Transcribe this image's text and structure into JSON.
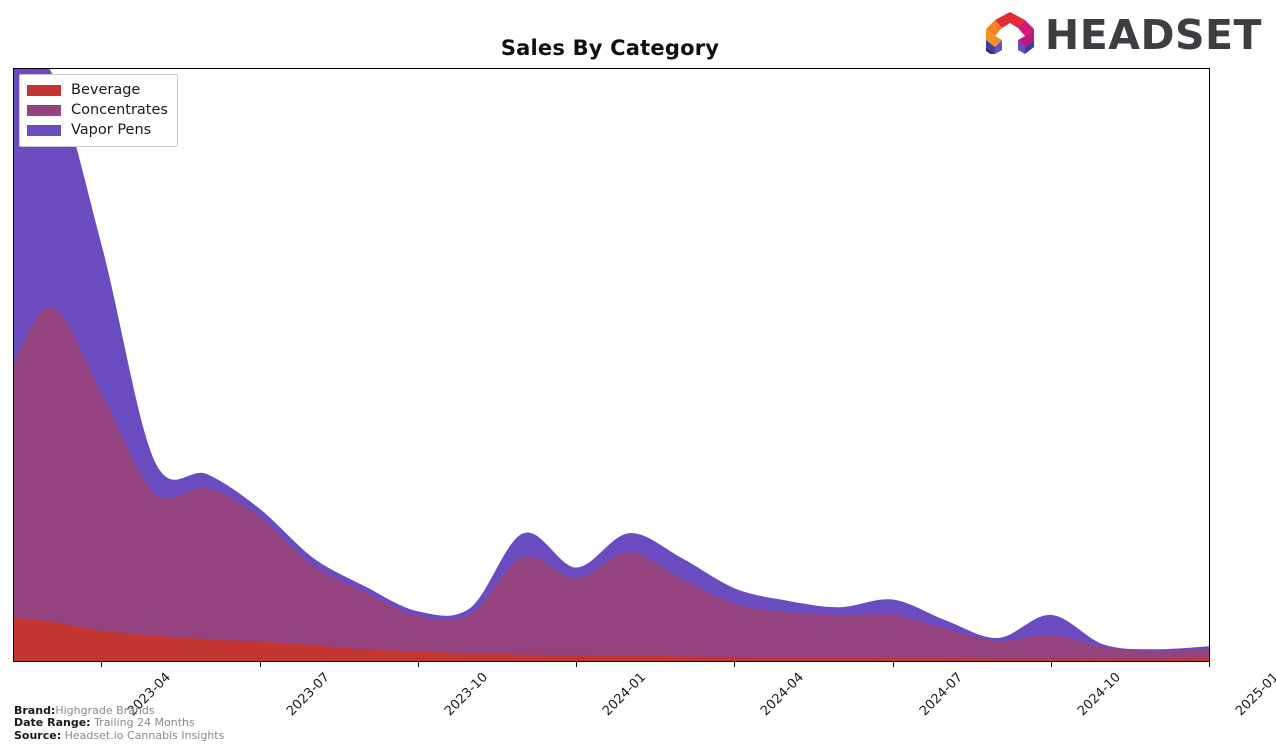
{
  "header": {
    "title": "Sales By Category",
    "logo_word": "HEADSET",
    "logo_icon": "headset-logo-icon"
  },
  "footer": {
    "brand_key": "Brand:",
    "brand_value": "Highgrade Brands",
    "date_range_key": "Date Range:",
    "date_range_value": "Trailing 24 Months",
    "source_key": "Source:",
    "source_value": "Headset.io Cannabis Insights"
  },
  "colors": {
    "beverage": "#c43431",
    "concentrates": "#94437f",
    "vapor_pens": "#6a4cc0",
    "axis": "#000000",
    "title": "#101010",
    "footer_text": "#8a8a8a",
    "logo_word": "#3e3e42"
  },
  "chart_data": {
    "type": "area",
    "stacked": true,
    "smoothed": true,
    "title": "Sales By Category",
    "xlabel": "",
    "ylabel": "",
    "grid": false,
    "legend_position": "upper-left",
    "axis_tick_labels": [
      "2023-04",
      "2023-07",
      "2023-10",
      "2024-01",
      "2024-04",
      "2024-07",
      "2024-10",
      "2025-01"
    ],
    "x": [
      "2023-02",
      "2023-03",
      "2023-04",
      "2023-05",
      "2023-06",
      "2023-07",
      "2023-08",
      "2023-09",
      "2023-10",
      "2023-11",
      "2023-12",
      "2024-01",
      "2024-02",
      "2024-03",
      "2024-04",
      "2024-05",
      "2024-06",
      "2024-07",
      "2024-08",
      "2024-09",
      "2024-10",
      "2024-11",
      "2024-12",
      "2025-01"
    ],
    "ylim": [
      0,
      100
    ],
    "series": [
      {
        "name": "Beverage",
        "color": "#c43431",
        "values": [
          7.5,
          6.6,
          5.0,
          4.2,
          3.6,
          3.2,
          2.6,
          1.9,
          1.5,
          1.2,
          1.0,
          0.9,
          0.8,
          0.7,
          0.6,
          0.5,
          0.5,
          0.4,
          0.4,
          0.3,
          0.3,
          0.3,
          0.3,
          0.4
        ]
      },
      {
        "name": "Concentrates",
        "color": "#94437f",
        "values": [
          35.0,
          53.0,
          40.0,
          24.0,
          25.5,
          21.0,
          13.5,
          9.6,
          6.0,
          6.6,
          16.5,
          13.0,
          17.5,
          13.0,
          9.0,
          7.6,
          7.2,
          7.3,
          5.0,
          3.0,
          4.0,
          2.0,
          1.3,
          1.6
        ]
      },
      {
        "name": "Vapor Pens",
        "color": "#6a4cc0",
        "values": [
          58.0,
          40.5,
          25.0,
          5.5,
          2.4,
          1.4,
          1.3,
          1.0,
          0.8,
          1.1,
          4.0,
          1.8,
          3.2,
          3.6,
          2.6,
          2.0,
          1.3,
          2.6,
          1.4,
          0.5,
          3.4,
          0.4,
          0.3,
          0.4
        ]
      }
    ]
  },
  "legend": {
    "items": [
      {
        "label": "Beverage",
        "color": "#c43431"
      },
      {
        "label": "Concentrates",
        "color": "#94437f"
      },
      {
        "label": "Vapor Pens",
        "color": "#6a4cc0"
      }
    ]
  }
}
